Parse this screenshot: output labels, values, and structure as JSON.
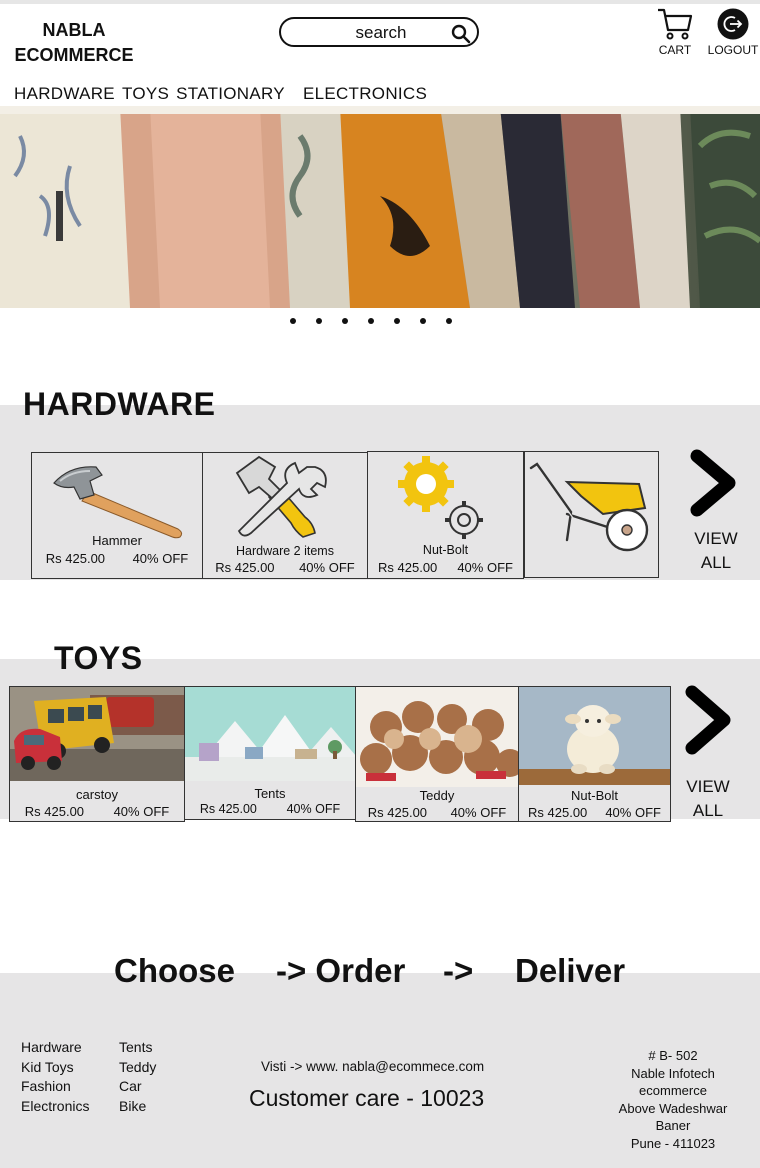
{
  "header": {
    "brand_line1": "NABLA",
    "brand_line2": "ECOMMERCE",
    "search_text": "search",
    "cart_label": "CART",
    "logout_label": "LOGOUT"
  },
  "nav": {
    "items": [
      "HARDWARE",
      "TOYS",
      "STATIONARY",
      "ELECTRONICS"
    ]
  },
  "carousel": {
    "dot_count": 7
  },
  "hardware": {
    "title": "HARDWARE",
    "items": [
      {
        "name": "Hammer",
        "price": "Rs 425.00",
        "discount": "40% OFF"
      },
      {
        "name": "Hardware 2 items",
        "price": "Rs 425.00",
        "discount": "40% OFF"
      },
      {
        "name": "Nut-Bolt",
        "price": "Rs 425.00",
        "discount": "40% OFF"
      }
    ],
    "view_all_line1": "VIEW",
    "view_all_line2": "ALL"
  },
  "toys": {
    "title": "TOYS",
    "items": [
      {
        "name": "carstoy",
        "price": "Rs 425.00",
        "discount": "40% OFF"
      },
      {
        "name": "Tents",
        "price": "Rs 425.00",
        "discount": "40% OFF"
      },
      {
        "name": "Teddy",
        "price": "Rs 425.00",
        "discount": "40% OFF"
      },
      {
        "name": "Nut-Bolt",
        "price": "Rs 425.00",
        "discount": "40% OFF"
      }
    ],
    "view_all_line1": "VIEW",
    "view_all_line2": "ALL"
  },
  "tagline": {
    "choose": "Choose",
    "order": "-> Order",
    "arrow": "->",
    "deliver": "Deliver"
  },
  "footer": {
    "col1": [
      "Hardware",
      "Kid Toys",
      "Fashion",
      "Electronics"
    ],
    "col2": [
      "Tents",
      "Teddy",
      "Car",
      "Bike"
    ],
    "visit": "Visti -> www. nabla@ecommece.com",
    "customer_care": "Customer care - 10023",
    "address": [
      "# B- 502",
      "Nable Infotech",
      "ecommerce",
      "Above Wadeshwar",
      "Baner",
      "Pune - 411023"
    ]
  },
  "colors": {
    "band_gray": "#e6e5e6",
    "accent_yellow": "#f2c40f",
    "handle_orange": "#e0a15e"
  }
}
